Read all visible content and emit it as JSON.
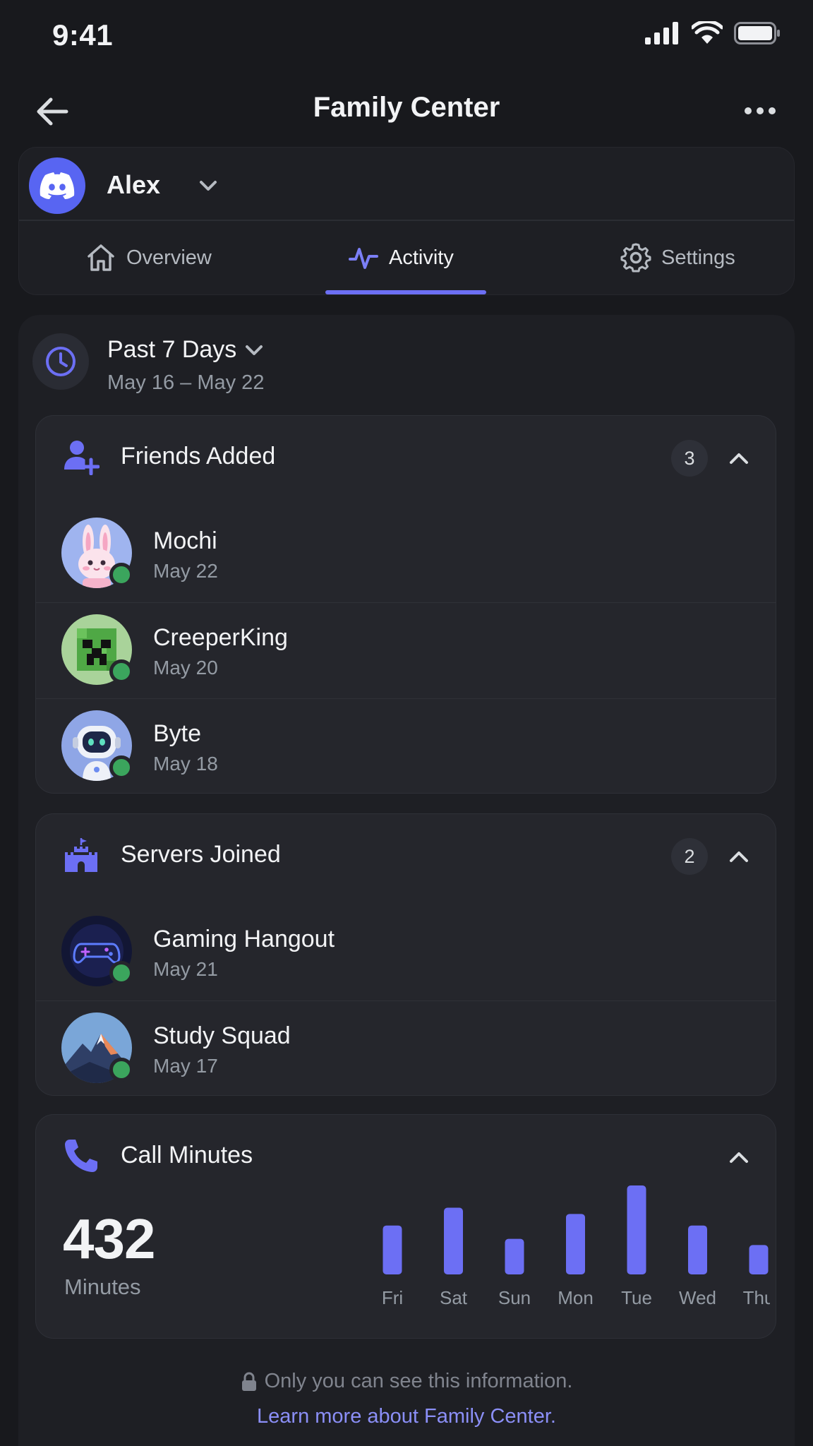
{
  "status_bar": {
    "time": "9:41"
  },
  "header": {
    "title": "Family Center"
  },
  "profile": {
    "name": "Alex"
  },
  "tabs": [
    {
      "label": "Overview",
      "icon": "home-icon",
      "active": false
    },
    {
      "label": "Activity",
      "icon": "activity-icon",
      "active": true
    },
    {
      "label": "Settings",
      "icon": "gear-icon",
      "active": false
    }
  ],
  "period": {
    "label": "Past 7 Days",
    "range": "May 16 – May 22"
  },
  "friends_added": {
    "title": "Friends Added",
    "count": "3",
    "items": [
      {
        "name": "Mochi",
        "date": "May 22",
        "avatar": "bunny-avatar"
      },
      {
        "name": "CreeperKing",
        "date": "May 20",
        "avatar": "creeper-avatar"
      },
      {
        "name": "Byte",
        "date": "May 18",
        "avatar": "robot-avatar"
      }
    ]
  },
  "servers_joined": {
    "title": "Servers Joined",
    "count": "2",
    "items": [
      {
        "name": "Gaming Hangout",
        "date": "May 21",
        "avatar": "gamepad-avatar"
      },
      {
        "name": "Study Squad",
        "date": "May 17",
        "avatar": "mountain-avatar"
      }
    ]
  },
  "call_minutes": {
    "title": "Call Minutes",
    "total": "432",
    "unit_label": "Minutes"
  },
  "chart_data": {
    "type": "bar",
    "categories": [
      "Fri",
      "Sat",
      "Sun",
      "Mon",
      "Tue",
      "Wed",
      "Thu"
    ],
    "values": [
      55,
      75,
      40,
      68,
      100,
      55,
      33
    ],
    "color": "#6c6ff4"
  },
  "footer": {
    "privacy_text": "Only you can see this information.",
    "learn_more": "Learn more about Family Center."
  },
  "colors": {
    "accent": "#6c6ff4",
    "online": "#3ba55d",
    "discord": "#5865f2"
  }
}
